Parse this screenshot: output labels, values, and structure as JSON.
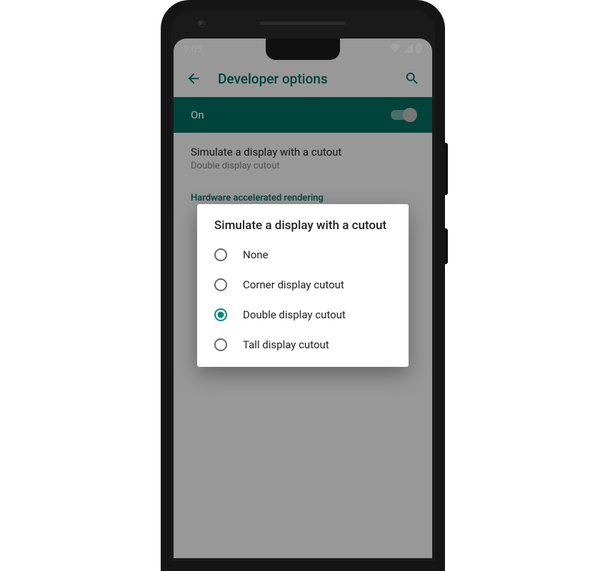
{
  "status": {
    "clock": "9:05",
    "wifi": true,
    "cell": true,
    "battery": true
  },
  "appbar": {
    "title": "Developer options"
  },
  "toggle": {
    "label": "On",
    "value": true
  },
  "setting": {
    "title": "Simulate a display with a cutout",
    "subtitle": "Double display cutout"
  },
  "category": {
    "header": "Hardware accelerated rendering"
  },
  "dialog": {
    "title": "Simulate a display with a cutout",
    "options": [
      {
        "label": "None",
        "checked": false
      },
      {
        "label": "Corner display cutout",
        "checked": false
      },
      {
        "label": "Double display cutout",
        "checked": true
      },
      {
        "label": "Tall display cutout",
        "checked": false
      }
    ]
  },
  "colors": {
    "accent": "#00695c",
    "radio_selected": "#00897b"
  }
}
